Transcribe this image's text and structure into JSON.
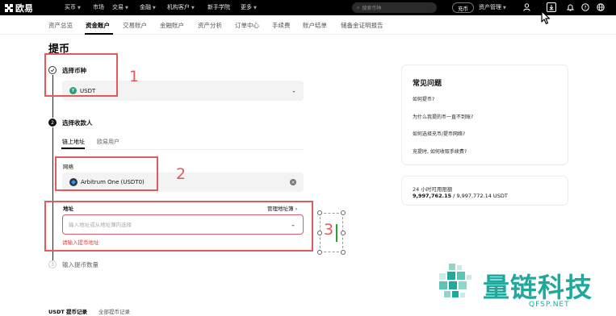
{
  "topnav": {
    "logo_text": "欧易",
    "items": [
      {
        "label": "买币",
        "caret": true
      },
      {
        "label": "市场",
        "caret": false
      },
      {
        "label": "交易",
        "caret": true
      },
      {
        "label": "金融",
        "caret": true
      },
      {
        "label": "机构客户",
        "caret": true
      },
      {
        "label": "新手学院",
        "caret": false
      },
      {
        "label": "更多",
        "caret": true
      }
    ],
    "search_placeholder": "搜索币种",
    "charge_label": "充币",
    "asset_mgmt_label": "资产管理"
  },
  "subnav": {
    "items": [
      "资产总览",
      "资金账户",
      "交易账户",
      "金融账户",
      "资产分析",
      "订单中心",
      "手续费",
      "账户结单",
      "储备金证明报告"
    ],
    "active_index": 1
  },
  "page_title": "提币",
  "steps": {
    "step1": {
      "label": "选择币种"
    },
    "step2": {
      "number": "2",
      "label": "选择收款人"
    },
    "step3": {
      "number": "3",
      "label": "输入提币数量"
    }
  },
  "coin_select": {
    "value": "USDT"
  },
  "recipient_tabs": [
    "链上地址",
    "欧易用户"
  ],
  "network": {
    "label": "网络",
    "value": "Arbitrum One (USDT0)"
  },
  "address": {
    "label": "地址",
    "book_link": "管理地址簿",
    "placeholder": "输入地址或从地址簿内选择",
    "error": "请输入提币地址"
  },
  "annotations": [
    "1",
    "2",
    "3"
  ],
  "faq": {
    "title": "常见问题",
    "links": [
      "如何提币?",
      "为什么我提的币一直不到账?",
      "如何选择充币/提币网络?",
      "充提时, 如何收取手续费?"
    ]
  },
  "limit": {
    "label": "24 小时可用限额",
    "used": "9,997,762.15",
    "total": " / 9,997,772.14 USDT"
  },
  "bottom_tabs": [
    "USDT 提币记录",
    "全部提币记录"
  ],
  "watermark": {
    "text": "量链科技",
    "url": "QFSP.NET"
  },
  "colors": {
    "annotation": "#e25a5a",
    "watermark": "#1fa99d",
    "error": "#dd4444"
  }
}
